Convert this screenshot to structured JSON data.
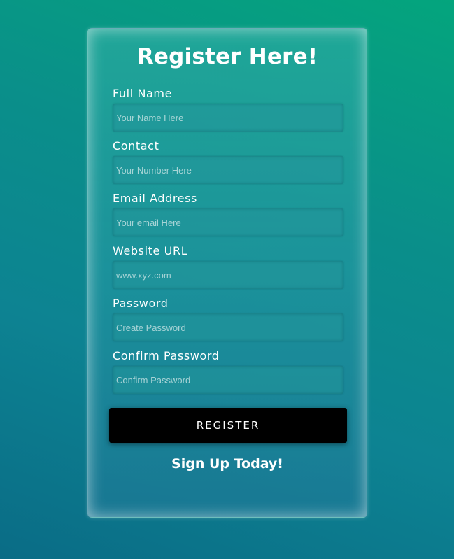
{
  "form": {
    "title": "Register Here!",
    "fields": [
      {
        "label": "Full Name",
        "placeholder": "Your Name Here",
        "value": ""
      },
      {
        "label": "Contact",
        "placeholder": "Your Number Here",
        "value": ""
      },
      {
        "label": "Email Address",
        "placeholder": "Your email Here",
        "value": ""
      },
      {
        "label": "Website URL",
        "placeholder": "www.xyz.com",
        "value": ""
      },
      {
        "label": "Password",
        "placeholder": "Create Password",
        "value": ""
      },
      {
        "label": "Confirm Password",
        "placeholder": "Confirm Password",
        "value": ""
      }
    ],
    "register_label": "REGISTER",
    "footer_text": "Sign Up Today!"
  },
  "colors": {
    "background_top": "#04a57d",
    "background_bottom": "#0a6c86",
    "button_bg": "#000000",
    "text": "#ffffff"
  }
}
